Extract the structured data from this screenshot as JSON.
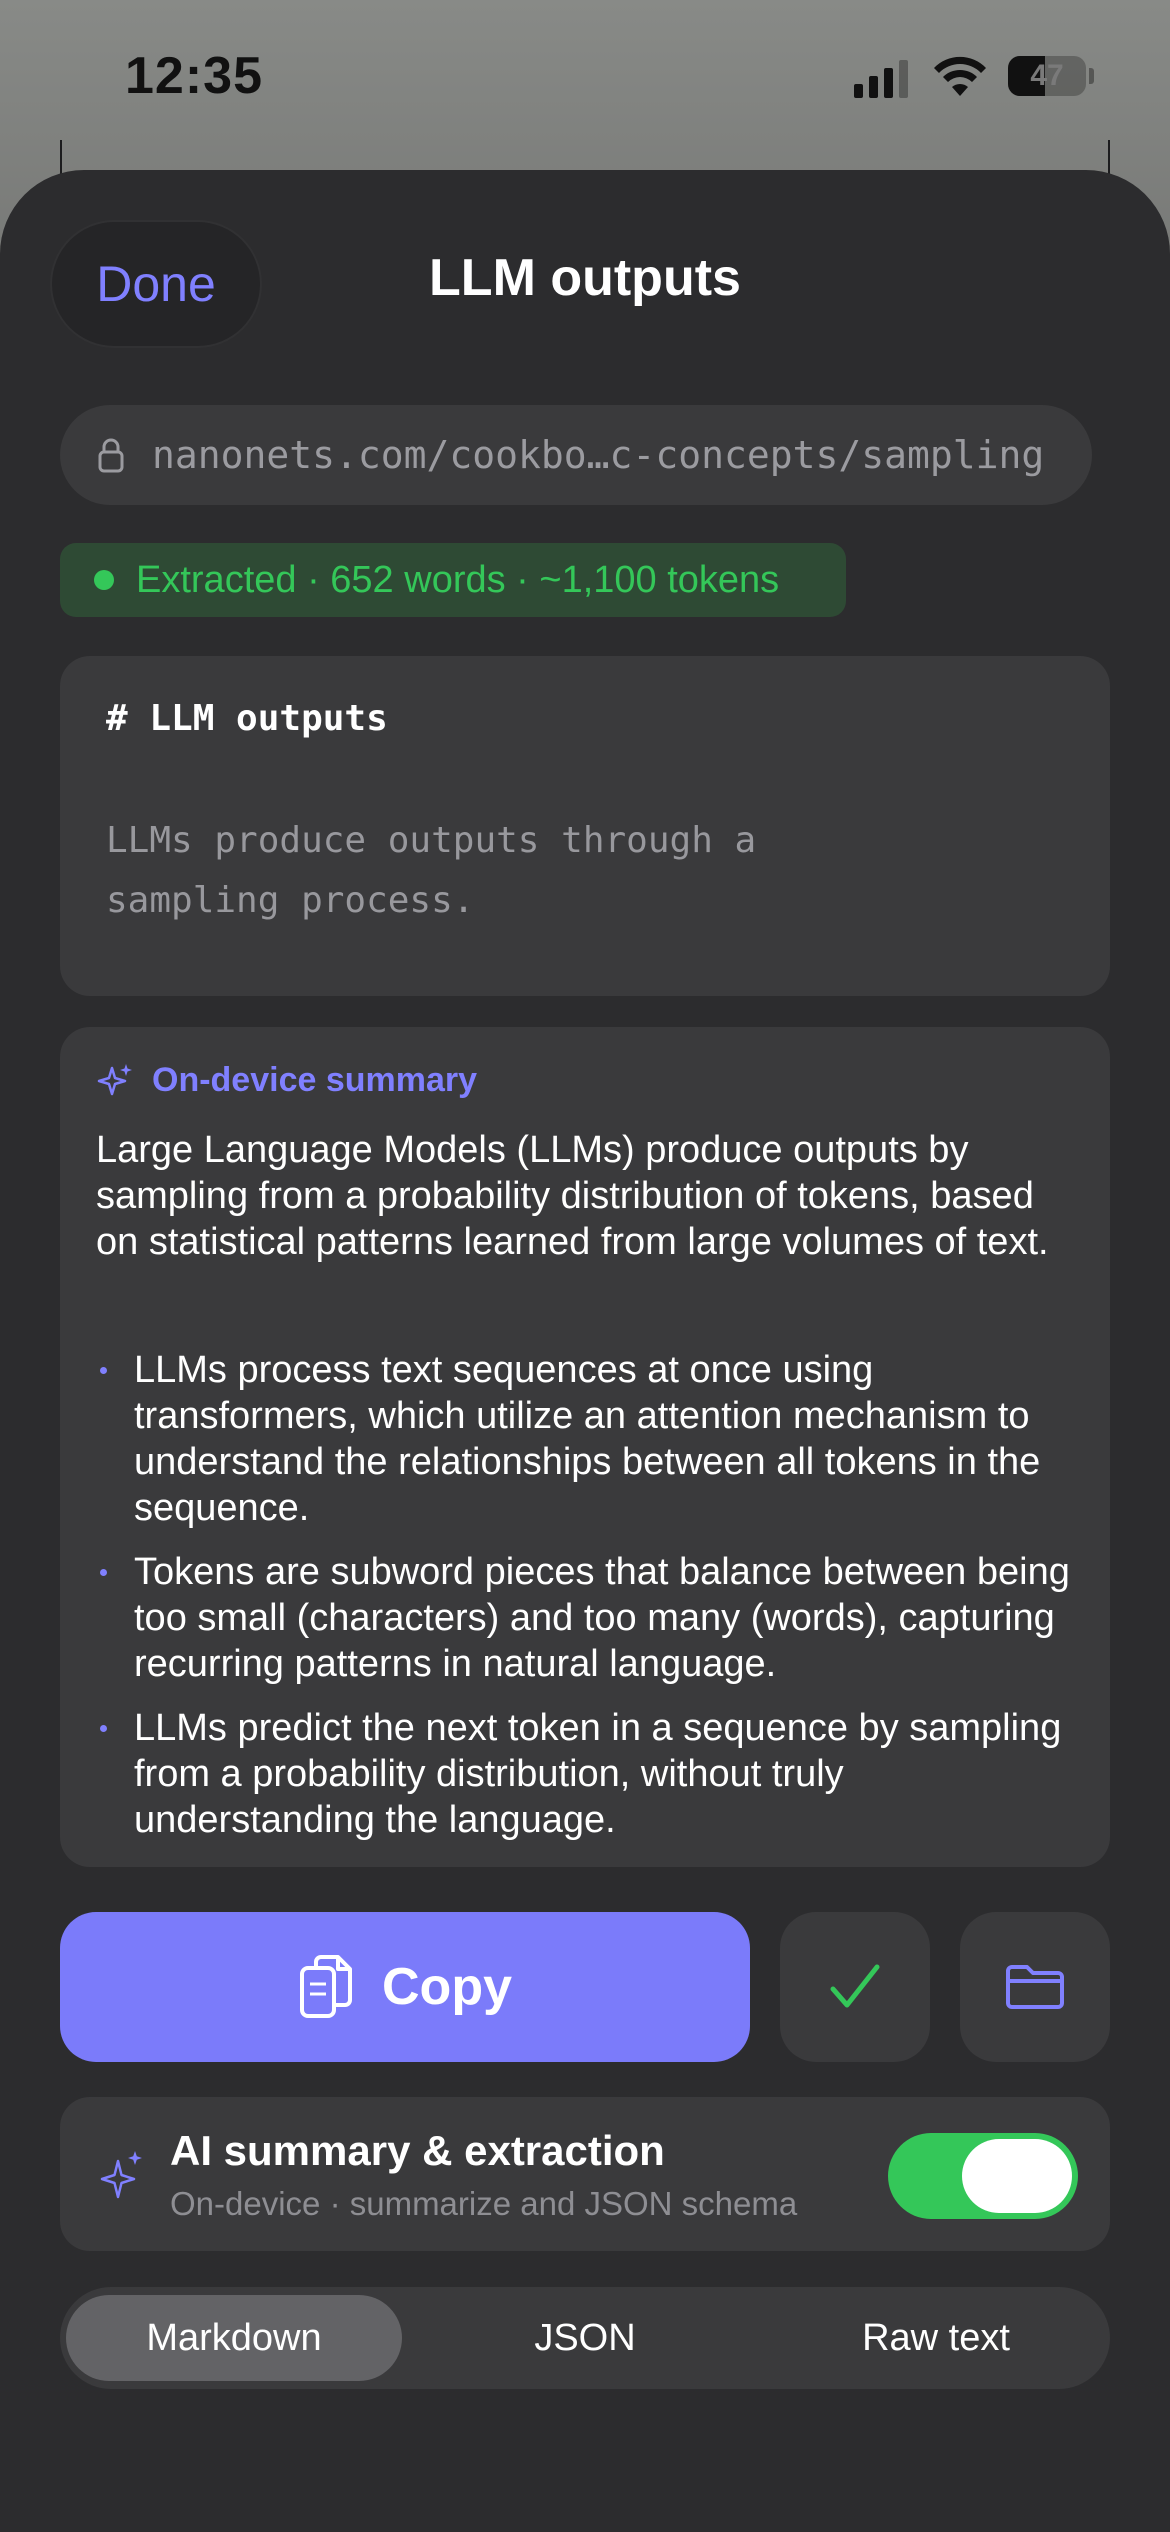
{
  "status_bar": {
    "time": "12:35",
    "battery_level": "47",
    "battery_fraction": 0.47
  },
  "sheet": {
    "done_label": "Done",
    "title": "LLM outputs"
  },
  "url_bar": {
    "icon": "lock-icon",
    "url": "nanonets.com/cookbo…c-concepts/sampling"
  },
  "extraction": {
    "status": "Extracted · 652 words · ~1,100 tokens",
    "color": "#34c759"
  },
  "markdown_preview": {
    "heading": "# LLM outputs",
    "paragraph_line1": "LLMs produce outputs through a",
    "paragraph_line2": "sampling process."
  },
  "summary": {
    "icon": "sparkle-icon",
    "label": "On-device summary",
    "intro": "Large Language Models (LLMs) produce outputs by sampling from a probability distribution of tokens, based on statistical patterns learned from large volumes of text.",
    "bullets": [
      "LLMs process text sequences at once using transformers, which utilize an attention mechanism to understand the relationships between all tokens in the sequence.",
      "Tokens are subword pieces that balance between being too small (characters) and too many (words), capturing recurring patterns in natural language.",
      "LLMs predict the next token in a sequence by sampling from a probability distribution, without truly understanding the language."
    ]
  },
  "actions": {
    "copy_label": "Copy",
    "copy_icon": "copy-icon",
    "confirm_icon": "checkmark-icon",
    "folder_icon": "folder-icon",
    "accent": "#7b7bfa"
  },
  "ai_toggle": {
    "title": "AI summary & extraction",
    "subtitle": "On-device · summarize and JSON schema",
    "enabled": true
  },
  "format_tabs": {
    "options": [
      "Markdown",
      "JSON",
      "Raw text"
    ],
    "selected": "Markdown"
  }
}
